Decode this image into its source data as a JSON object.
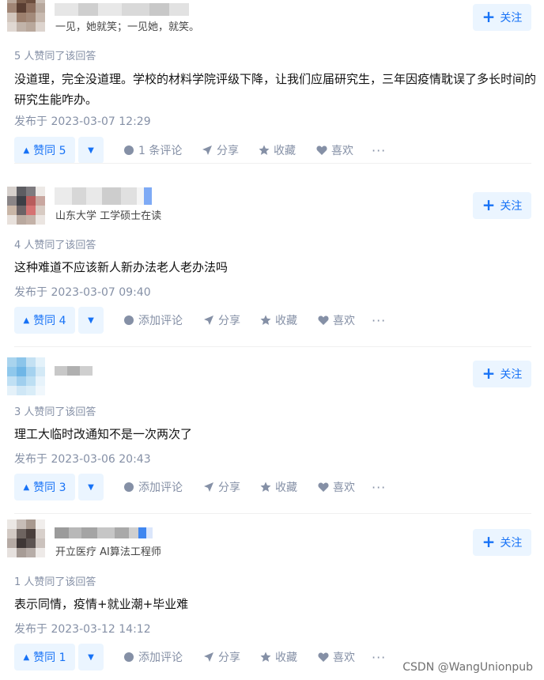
{
  "follow_label": "关注",
  "more_label": "···",
  "answers": [
    {
      "bio": "一见，她就笑；一见她，就笑。",
      "votes_line": "5 人赞同了该回答",
      "content": "没道理，完全没道理。学校的材料学院评级下降，让我们应届研究生，三年因疫情耽误了多长时间的研究生能咋办。",
      "date": "发布于 2023-03-07 12:29",
      "upvote_label": "赞同 5",
      "comment_label": "1 条评论",
      "share_label": "分享",
      "collect_label": "收藏",
      "like_label": "喜欢"
    },
    {
      "bio": "山东大学 工学硕士在读",
      "votes_line": "4 人赞同了该回答",
      "content": "这种难道不应该新人新办法老人老办法吗",
      "date": "发布于 2023-03-07 09:40",
      "upvote_label": "赞同 4",
      "comment_label": "添加评论",
      "share_label": "分享",
      "collect_label": "收藏",
      "like_label": "喜欢"
    },
    {
      "bio": "",
      "votes_line": "3 人赞同了该回答",
      "content": "理工大临时改通知不是一次两次了",
      "date": "发布于 2023-03-06 20:43",
      "upvote_label": "赞同 3",
      "comment_label": "添加评论",
      "share_label": "分享",
      "collect_label": "收藏",
      "like_label": "喜欢"
    },
    {
      "bio": "开立医疗 AI算法工程师",
      "votes_line": "1 人赞同了该回答",
      "content": "表示同情，疫情+就业潮+毕业难",
      "date": "发布于 2023-03-12 14:12",
      "upvote_label": "赞同 1",
      "comment_label": "添加评论",
      "share_label": "分享",
      "collect_label": "收藏",
      "like_label": "喜欢"
    }
  ],
  "watermark": "CSDN @WangUnionpub"
}
